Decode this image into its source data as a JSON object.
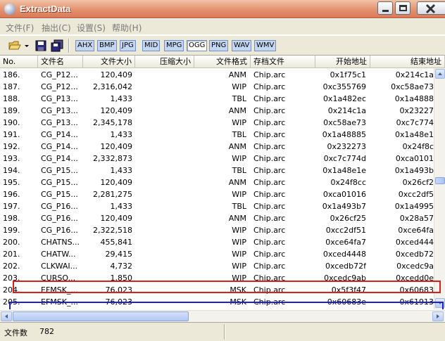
{
  "window": {
    "title": "ExtractData"
  },
  "menu": [
    {
      "label": "文件(F)"
    },
    {
      "label": "抽出(C)"
    },
    {
      "label": "设置(S)"
    },
    {
      "label": "帮助(H)"
    }
  ],
  "toolbar": {
    "formats": [
      "AHX",
      "BMP",
      "JPG",
      "MID",
      "MPG",
      "OGG",
      "PNG",
      "WAV",
      "WMV"
    ],
    "pressed_format": "OGG"
  },
  "columns": [
    "No.",
    "文件名",
    "文件大小",
    "压缩大小",
    "文件格式",
    "存档文件",
    "开始地址",
    "结束地址"
  ],
  "rows": [
    {
      "no": "186.",
      "name": "CG_P12...",
      "size": "120,409",
      "csize": "",
      "fmt": "ANM",
      "archive": "Chip.arc",
      "start": "0x1f75c1",
      "end": "0x214c1a"
    },
    {
      "no": "187.",
      "name": "CG_P12...",
      "size": "2,316,042",
      "csize": "",
      "fmt": "WIP",
      "archive": "Chip.arc",
      "start": "0xc355769",
      "end": "0xc58ae73"
    },
    {
      "no": "188.",
      "name": "CG_P13...",
      "size": "1,433",
      "csize": "",
      "fmt": "TBL",
      "archive": "Chip.arc",
      "start": "0x1a482ec",
      "end": "0x1a4888"
    },
    {
      "no": "189.",
      "name": "CG_P13...",
      "size": "120,409",
      "csize": "",
      "fmt": "ANM",
      "archive": "Chip.arc",
      "start": "0x214c1a",
      "end": "0x23227"
    },
    {
      "no": "190.",
      "name": "CG_P13...",
      "size": "2,345,178",
      "csize": "",
      "fmt": "WIP",
      "archive": "Chip.arc",
      "start": "0xc58ae73",
      "end": "0xc7c774"
    },
    {
      "no": "191.",
      "name": "CG_P14...",
      "size": "1,433",
      "csize": "",
      "fmt": "TBL",
      "archive": "Chip.arc",
      "start": "0x1a48885",
      "end": "0x1a48e1"
    },
    {
      "no": "192.",
      "name": "CG_P14...",
      "size": "120,409",
      "csize": "",
      "fmt": "ANM",
      "archive": "Chip.arc",
      "start": "0x232273",
      "end": "0x24f8c"
    },
    {
      "no": "193.",
      "name": "CG_P14...",
      "size": "2,332,873",
      "csize": "",
      "fmt": "WIP",
      "archive": "Chip.arc",
      "start": "0xc7c774d",
      "end": "0xca0101"
    },
    {
      "no": "194.",
      "name": "CG_P15...",
      "size": "1,433",
      "csize": "",
      "fmt": "TBL",
      "archive": "Chip.arc",
      "start": "0x1a48e1e",
      "end": "0x1a493b"
    },
    {
      "no": "195.",
      "name": "CG_P15...",
      "size": "120,409",
      "csize": "",
      "fmt": "ANM",
      "archive": "Chip.arc",
      "start": "0x24f8cc",
      "end": "0x26cf2"
    },
    {
      "no": "196.",
      "name": "CG_P15...",
      "size": "2,281,275",
      "csize": "",
      "fmt": "WIP",
      "archive": "Chip.arc",
      "start": "0xca01016",
      "end": "0xcc2df5"
    },
    {
      "no": "197.",
      "name": "CG_P16...",
      "size": "1,433",
      "csize": "",
      "fmt": "TBL",
      "archive": "Chip.arc",
      "start": "0x1a493b7",
      "end": "0x1a4995"
    },
    {
      "no": "198.",
      "name": "CG_P16...",
      "size": "120,409",
      "csize": "",
      "fmt": "ANM",
      "archive": "Chip.arc",
      "start": "0x26cf25",
      "end": "0x28a57"
    },
    {
      "no": "199.",
      "name": "CG_P16...",
      "size": "2,322,518",
      "csize": "",
      "fmt": "WIP",
      "archive": "Chip.arc",
      "start": "0xcc2df51",
      "end": "0xce64fa"
    },
    {
      "no": "200.",
      "name": "CHATNS...",
      "size": "455,841",
      "csize": "",
      "fmt": "WIP",
      "archive": "Chip.arc",
      "start": "0xce64fa7",
      "end": "0xced444"
    },
    {
      "no": "201.",
      "name": "CHATW...",
      "size": "29,415",
      "csize": "",
      "fmt": "WIP",
      "archive": "Chip.arc",
      "start": "0xced4448",
      "end": "0xcedb72"
    },
    {
      "no": "202.",
      "name": "CLKWAI...",
      "size": "4,732",
      "csize": "",
      "fmt": "WIP",
      "archive": "Chip.arc",
      "start": "0xcedb72f",
      "end": "0xcedc9a"
    },
    {
      "no": "203.",
      "name": "CURSO...",
      "size": "1,850",
      "csize": "",
      "fmt": "WIP",
      "archive": "Chip.arc",
      "start": "0xcedc9ab",
      "end": "0xcedd0e"
    },
    {
      "no": "204.",
      "name": "EFMSK_...",
      "size": "76,023",
      "csize": "",
      "fmt": "MSK",
      "archive": "Chip.arc",
      "start": "0x5f3f47",
      "end": "0x60683"
    },
    {
      "no": "205.",
      "name": "EFMSK_...",
      "size": "76,023",
      "csize": "",
      "fmt": "MSK",
      "archive": "Chip.arc",
      "start": "0x60683e",
      "end": "0x61913"
    }
  ],
  "status": {
    "label": "文件数",
    "value": "782"
  },
  "highlights": {
    "red_row": "199.",
    "blue_row": "201.",
    "red_color": "#d42020",
    "blue_color": "#2020c8"
  },
  "colors": {
    "title_gradient": "#e4916f",
    "chrome": "#ece9d8",
    "format_button": "#c4d6f3"
  },
  "icons": [
    "app-icon",
    "minimize-icon",
    "maximize-icon",
    "close-icon",
    "open-folder-icon",
    "dropdown-arrow-icon",
    "save-icon",
    "save-all-icon"
  ]
}
